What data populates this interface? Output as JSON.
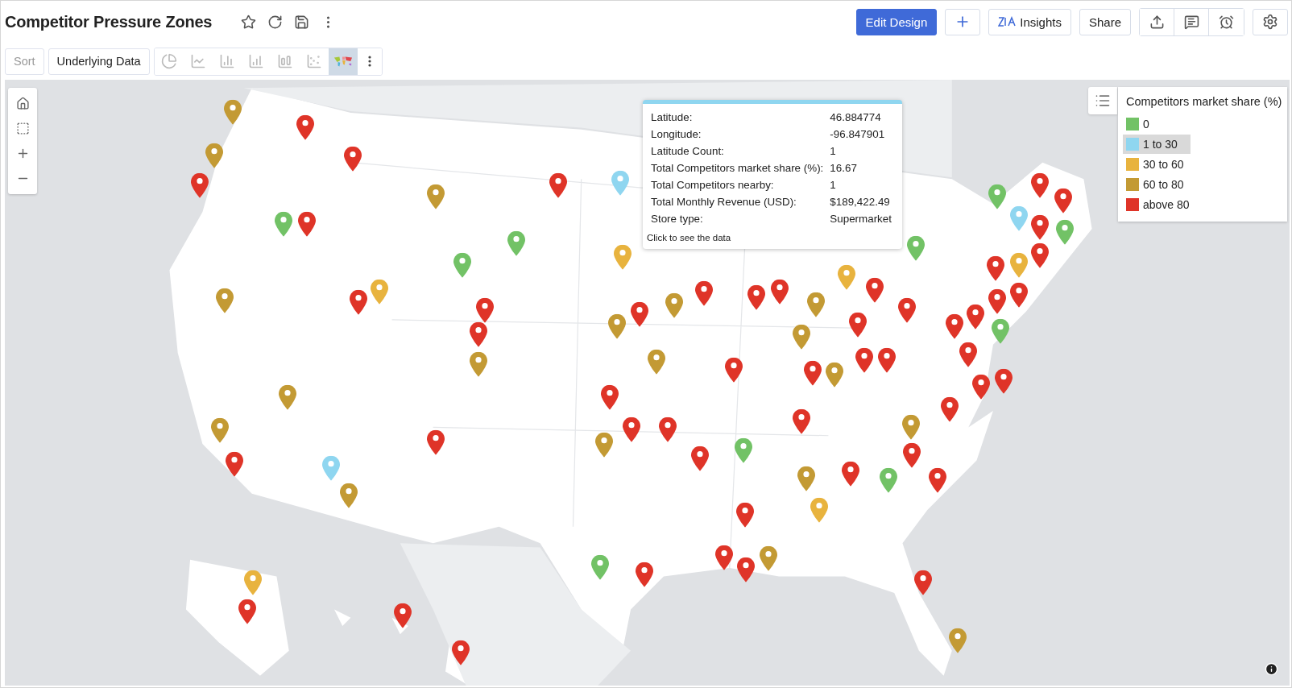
{
  "title": "Competitor Pressure Zones",
  "header_buttons": [
    {
      "kind": "primary",
      "label": "Edit Design"
    },
    {
      "kind": "add"
    },
    {
      "kind": "insights",
      "label": "Insights"
    },
    {
      "kind": "plain",
      "label": "Share"
    }
  ],
  "toolbar": {
    "sort": {
      "label": "Sort",
      "disabled": true
    },
    "underlying_data": "Underlying Data",
    "chart_types": [
      {
        "kind": "pie",
        "selected": false
      },
      {
        "kind": "line",
        "selected": false
      },
      {
        "kind": "bar",
        "selected": false
      },
      {
        "kind": "stacked",
        "selected": false
      },
      {
        "kind": "combo",
        "selected": false
      },
      {
        "kind": "scatter",
        "selected": false
      },
      {
        "kind": "map",
        "selected": true
      }
    ]
  },
  "tooltip": {
    "rows": [
      {
        "label": "Latitude:",
        "value": "46.884774"
      },
      {
        "label": "Longitude:",
        "value": "-96.847901"
      },
      {
        "label": "Latitude Count:",
        "value": "1"
      },
      {
        "label": "Total Competitors market share (%):",
        "value": "16.67"
      },
      {
        "label": "Total Competitors nearby:",
        "value": "1"
      },
      {
        "label": "Total Monthly Revenue (USD):",
        "value": "$189,422.49"
      },
      {
        "label": "Store type:",
        "value": "Supermarket"
      }
    ],
    "footer": "Click to see the data"
  },
  "legend": {
    "title": "Competitors market share (%)",
    "items": [
      {
        "label": "0",
        "color": "#72c266",
        "selected": false
      },
      {
        "label": "1 to 30",
        "color": "#8fd6f0",
        "selected": true
      },
      {
        "label": "30 to 60",
        "color": "#e8b33e",
        "selected": false
      },
      {
        "label": "60 to 80",
        "color": "#c39a34",
        "selected": false
      },
      {
        "label": "above 80",
        "color": "#df3428",
        "selected": false
      }
    ]
  },
  "pins": [
    {
      "color": "#c39a34"
    },
    {
      "color": "#df3428"
    },
    {
      "color": "#c39a34"
    },
    {
      "color": "#df3428"
    },
    {
      "color": "#df3428"
    },
    {
      "color": "#c39a34"
    },
    {
      "color": "#72c266"
    },
    {
      "color": "#df3428"
    },
    {
      "color": "#df3428"
    },
    {
      "color": "#8fd6f0"
    },
    {
      "color": "#72c266"
    },
    {
      "color": "#72c266"
    },
    {
      "color": "#e8b33e"
    },
    {
      "color": "#c39a34"
    },
    {
      "color": "#e8b33e"
    },
    {
      "color": "#df3428"
    },
    {
      "color": "#df3428"
    },
    {
      "color": "#df3428"
    },
    {
      "color": "#c39a34"
    },
    {
      "color": "#c39a34"
    },
    {
      "color": "#df3428"
    },
    {
      "color": "#c39a34"
    },
    {
      "color": "#df3428"
    },
    {
      "color": "#df3428"
    },
    {
      "color": "#df3428"
    },
    {
      "color": "#c39a34"
    },
    {
      "color": "#c39a34"
    },
    {
      "color": "#e8b33e"
    },
    {
      "color": "#df3428"
    },
    {
      "color": "#df3428"
    },
    {
      "color": "#df3428"
    },
    {
      "color": "#72c266"
    },
    {
      "color": "#72c266"
    },
    {
      "color": "#df3428"
    },
    {
      "color": "#df3428"
    },
    {
      "color": "#8fd6f0"
    },
    {
      "color": "#72c266"
    },
    {
      "color": "#df3428"
    },
    {
      "color": "#df3428"
    },
    {
      "color": "#e8b33e"
    },
    {
      "color": "#df3428"
    },
    {
      "color": "#df3428"
    },
    {
      "color": "#df3428"
    },
    {
      "color": "#df3428"
    },
    {
      "color": "#df3428"
    },
    {
      "color": "#df3428"
    },
    {
      "color": "#72c266"
    },
    {
      "color": "#df3428"
    },
    {
      "color": "#df3428"
    },
    {
      "color": "#c39a34"
    },
    {
      "color": "#df3428"
    },
    {
      "color": "#df3428"
    },
    {
      "color": "#c39a34"
    },
    {
      "color": "#df3428"
    },
    {
      "color": "#df3428"
    },
    {
      "color": "#c39a34"
    },
    {
      "color": "#df3428"
    },
    {
      "color": "#df3428"
    },
    {
      "color": "#df3428"
    },
    {
      "color": "#c39a34"
    },
    {
      "color": "#c39a34"
    },
    {
      "color": "#df3428"
    },
    {
      "color": "#df3428"
    },
    {
      "color": "#df3428"
    },
    {
      "color": "#c39a34"
    },
    {
      "color": "#72c266"
    },
    {
      "color": "#df3428"
    },
    {
      "color": "#df3428"
    },
    {
      "color": "#df3428"
    },
    {
      "color": "#8fd6f0"
    },
    {
      "color": "#df3428"
    },
    {
      "color": "#72c266"
    },
    {
      "color": "#df3428"
    },
    {
      "color": "#c39a34"
    },
    {
      "color": "#e8b33e"
    },
    {
      "color": "#c39a34"
    },
    {
      "color": "#df3428"
    },
    {
      "color": "#df3428"
    },
    {
      "color": "#df3428"
    },
    {
      "color": "#c39a34"
    },
    {
      "color": "#72c266"
    },
    {
      "color": "#df3428"
    },
    {
      "color": "#df3428"
    },
    {
      "color": "#e8b33e"
    },
    {
      "color": "#df3428"
    },
    {
      "color": "#df3428"
    },
    {
      "color": "#df3428"
    },
    {
      "color": "#c39a34"
    }
  ]
}
